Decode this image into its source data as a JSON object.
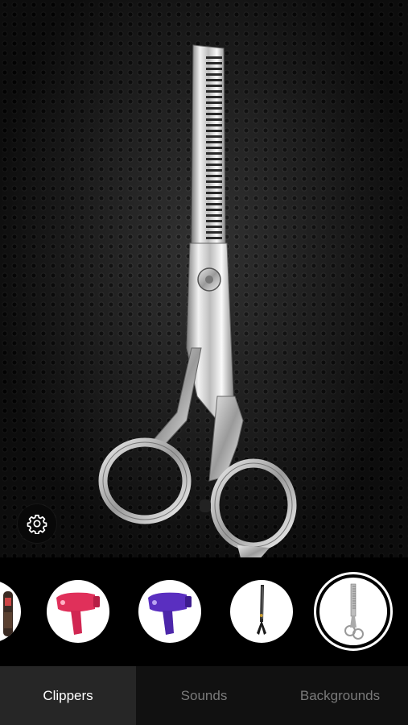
{
  "scene": {
    "tool_selected": "thinning-scissors-icon"
  },
  "carousel": {
    "items": [
      {
        "name": "beard-trimmer-icon",
        "selected": false
      },
      {
        "name": "pink-hair-dryer-icon",
        "selected": false,
        "color": "#e0305a"
      },
      {
        "name": "purple-hair-dryer-icon",
        "selected": false,
        "color": "#5a2fc0"
      },
      {
        "name": "hair-scissors-icon",
        "selected": false
      },
      {
        "name": "thinning-scissors-icon",
        "selected": true
      }
    ]
  },
  "settings": {
    "icon": "gear-icon"
  },
  "tabs": [
    {
      "label": "Clippers",
      "active": true
    },
    {
      "label": "Sounds",
      "active": false
    },
    {
      "label": "Backgrounds",
      "active": false
    }
  ],
  "colors": {
    "tab_active_bg": "#262626",
    "tab_bg": "#111111",
    "tab_active_text": "#ffffff",
    "tab_text": "#7a7a7a"
  }
}
